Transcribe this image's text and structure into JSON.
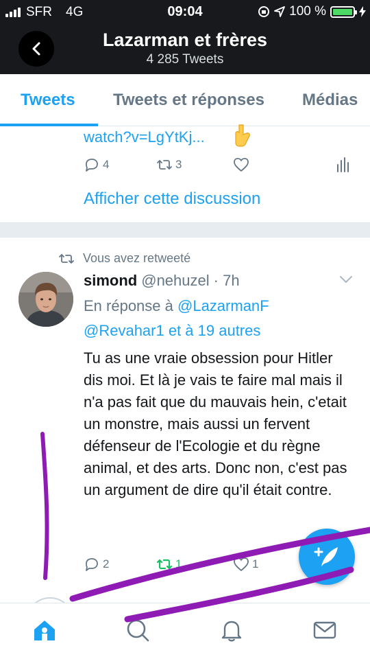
{
  "status_bar": {
    "carrier": "SFR",
    "network": "4G",
    "time": "09:04",
    "battery": "100 %",
    "battery_level": 1.0
  },
  "header": {
    "title": "Lazarman et frères",
    "subtitle": "4 285 Tweets"
  },
  "tabs": [
    {
      "label": "Tweets",
      "active": true
    },
    {
      "label": "Tweets et réponses",
      "active": false
    },
    {
      "label": "Médias",
      "active": false
    }
  ],
  "tweet_1": {
    "link_text": "watch?v=LgYtKj...",
    "replies": "4",
    "retweets": "3",
    "show_thread": "Afficher cette discussion"
  },
  "tweet_2": {
    "retweeted_by": "Vous avez retweeté",
    "author_name": "simond",
    "author_handle": "@nehuzel",
    "time": "· 7h",
    "reply_prefix": "En réponse à",
    "reply_mention_1": "@LazarmanF",
    "reply_mention_2": "@Revahar1 et à 19 autres",
    "body": "Tu as une vraie obsession pour Hitler dis moi. Et là je vais te faire mal mais il n'a pas fait que du mauvais hein, c'etait un monstre, mais aussi un fervent défenseur de l'Ecologie et du règne animal, et des arts. Donc non, c'est pas un argument de dire qu'il était contre.",
    "replies": "2",
    "retweets": "1",
    "likes": "1"
  },
  "colors": {
    "accent": "#1da1f2",
    "retweet_green": "#17bf63",
    "annotation_purple": "#8d1bb4",
    "header_bg": "#17191c"
  },
  "icons": [
    "back-arrow-icon",
    "hand-pointing-down-icon",
    "reply-icon",
    "retweet-icon",
    "like-icon",
    "analytics-icon",
    "chevron-down-icon",
    "compose-icon",
    "home-icon",
    "search-icon",
    "notifications-icon",
    "messages-icon"
  ]
}
